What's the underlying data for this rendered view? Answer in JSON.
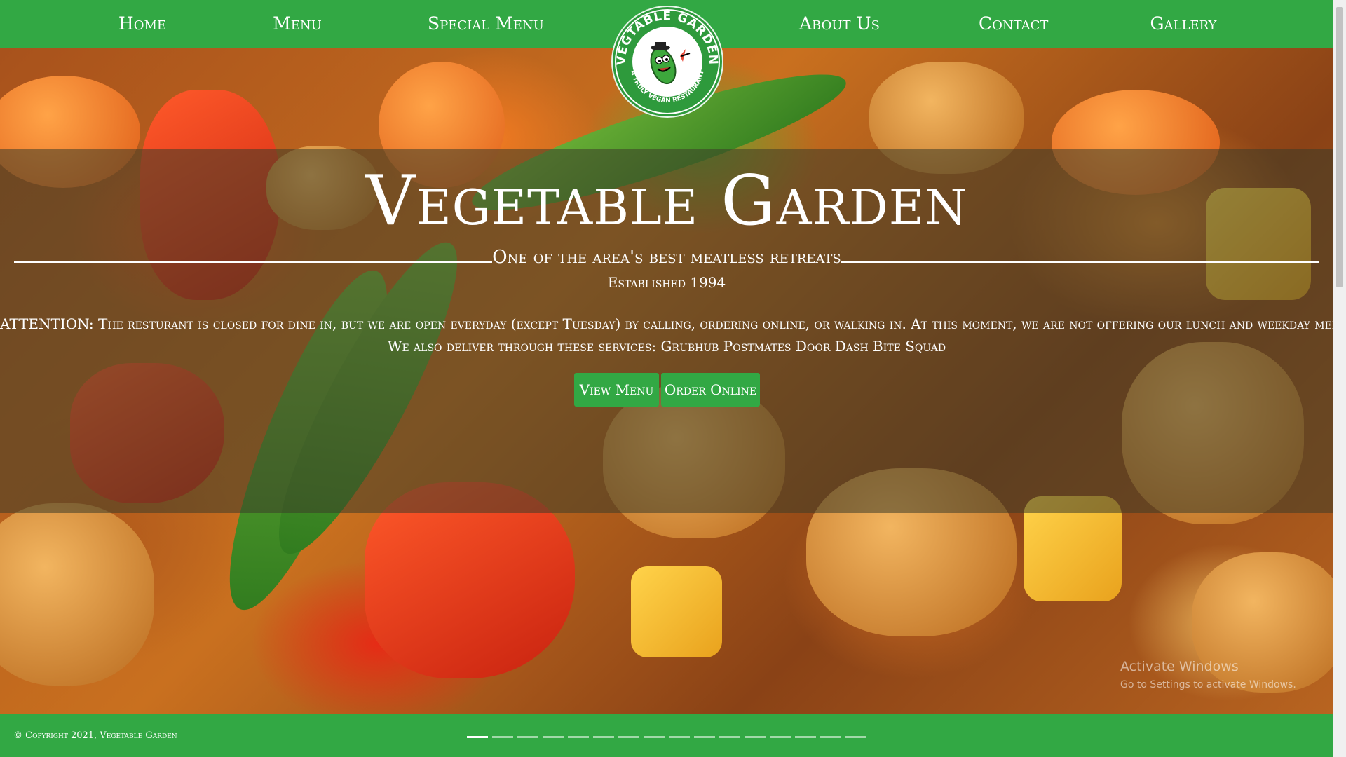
{
  "nav": {
    "items": [
      {
        "label": "Home"
      },
      {
        "label": "Menu"
      },
      {
        "label": "Special Menu"
      },
      {
        "label": "About Us"
      },
      {
        "label": "Contact"
      },
      {
        "label": "Gallery"
      }
    ]
  },
  "logo": {
    "top_text": "VEGTABLE GARDEN",
    "bottom_text": "A TRULY VEGAN RESTAURANT"
  },
  "hero": {
    "title": "Vegetable Garden",
    "tagline": "One of the area's best meatless retreats",
    "established": "Established 1994",
    "attention": "ATTENTION: The resturant is closed for dine in, but we are open everyday (except Tuesday) by calling, ordering online, or walking in. At this moment, we are not offering our lunch and weekday menus.",
    "delivery": "We also deliver through these services: Grubhub Postmates Door Dash Bite Squad",
    "buttons": {
      "view_menu": "View Menu",
      "order_online": "Order Online"
    }
  },
  "windows_watermark": {
    "title": "Activate Windows",
    "subtitle": "Go to Settings to activate Windows."
  },
  "footer": {
    "copyright": "© Copyright 2021, Vegetable Garden",
    "slider_count": 16,
    "active_slide": 1
  },
  "colors": {
    "brand_green": "#32a844",
    "text": "#ffffff"
  }
}
